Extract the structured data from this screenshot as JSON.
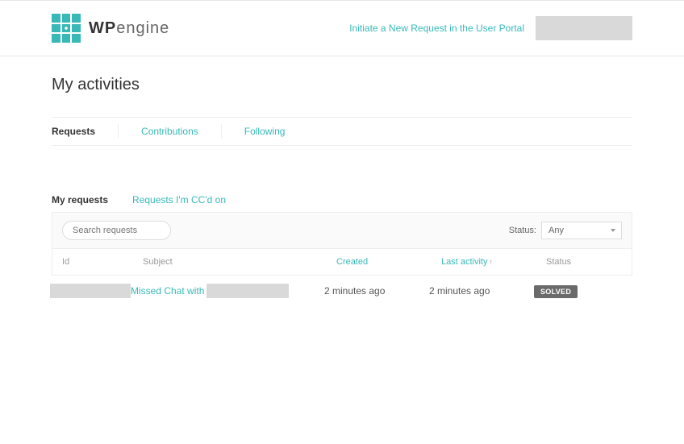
{
  "logo": {
    "wp": "WP",
    "engine": "engine"
  },
  "header": {
    "portal_link": "Initiate a New Request in the User Portal"
  },
  "page": {
    "title": "My activities"
  },
  "tabs": {
    "requests": "Requests",
    "contributions": "Contributions",
    "following": "Following"
  },
  "subtabs": {
    "my_requests": "My requests",
    "ccd": "Requests I'm CC'd on"
  },
  "search": {
    "placeholder": "Search requests"
  },
  "filter": {
    "status_label": "Status:",
    "status_value": "Any"
  },
  "table": {
    "headers": {
      "id": "Id",
      "subject": "Subject",
      "created": "Created",
      "last_activity": "Last activity",
      "status": "Status"
    },
    "sort_indicator": "↑"
  },
  "rows": [
    {
      "subject": "Missed Chat with",
      "created": "2 minutes ago",
      "last_activity": "2 minutes ago",
      "status": "SOLVED"
    }
  ]
}
